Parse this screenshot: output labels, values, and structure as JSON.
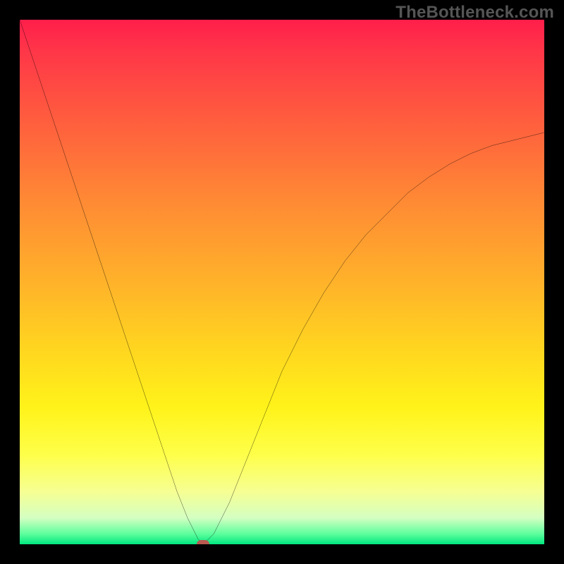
{
  "watermark": "TheBottleneck.com",
  "colors": {
    "frame": "#000000",
    "curve": "#000000",
    "marker": "#b85a50"
  },
  "chart_data": {
    "type": "line",
    "title": "",
    "xlabel": "",
    "ylabel": "",
    "xlim": [
      0,
      100
    ],
    "ylim": [
      0,
      100
    ],
    "grid": false,
    "legend": false,
    "series": [
      {
        "name": "curve",
        "x": [
          0,
          2,
          4,
          6,
          8,
          10,
          12,
          14,
          16,
          18,
          20,
          22,
          24,
          26,
          28,
          30,
          32,
          33,
          34,
          35,
          36,
          37,
          38,
          40,
          42,
          44,
          46,
          48,
          50,
          54,
          58,
          62,
          66,
          70,
          74,
          78,
          82,
          86,
          90,
          94,
          98,
          100
        ],
        "y": [
          100,
          94,
          88,
          82,
          76,
          70,
          64,
          58,
          52,
          46,
          40,
          34,
          28,
          22,
          16,
          10,
          5,
          3,
          1,
          0,
          1,
          2,
          4,
          8,
          13,
          18,
          23,
          28,
          33,
          41,
          48,
          54,
          59,
          63,
          67,
          70,
          72.5,
          74.5,
          76,
          77,
          78,
          78.5
        ]
      }
    ],
    "marker": {
      "x": 35,
      "y": 0
    },
    "background_gradient_stops": [
      {
        "pct": 0,
        "color": "#ff1e4b"
      },
      {
        "pct": 6,
        "color": "#ff3648"
      },
      {
        "pct": 18,
        "color": "#ff5a3f"
      },
      {
        "pct": 35,
        "color": "#ff8b34"
      },
      {
        "pct": 50,
        "color": "#ffb22a"
      },
      {
        "pct": 63,
        "color": "#ffd61f"
      },
      {
        "pct": 74,
        "color": "#fff31a"
      },
      {
        "pct": 83,
        "color": "#feff4a"
      },
      {
        "pct": 90,
        "color": "#f6ff93"
      },
      {
        "pct": 95,
        "color": "#d4ffc2"
      },
      {
        "pct": 98,
        "color": "#5eff9d"
      },
      {
        "pct": 100,
        "color": "#00e780"
      }
    ]
  }
}
